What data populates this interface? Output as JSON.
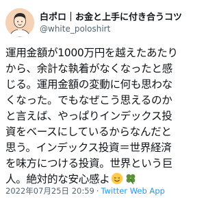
{
  "author": {
    "display_name": "白ポロ｜お金と上手に付き合うコツ",
    "handle": "@white_poloshirt"
  },
  "tweet": {
    "lines": [
      "運用金額が1000万円を越えたあたり",
      "から、余計な執着がなくなったと感",
      "じる。運用金額の変動に何も思わな",
      "くなった。でもなぜこう思えるのか",
      "と言えば、やっぱりインデックス投",
      "資をベースにしているからなんだと",
      "思う。インデックス投資＝世界経済",
      "を味方につける投資。世界という巨",
      "人。絶対的な安心感よ"
    ],
    "emojis": [
      "relieved-face-icon",
      "four-leaf-clover-icon"
    ]
  },
  "meta": {
    "timestamp": "2022年07月25日 20:59",
    "separator": "·",
    "source": "Twitter Web App"
  }
}
